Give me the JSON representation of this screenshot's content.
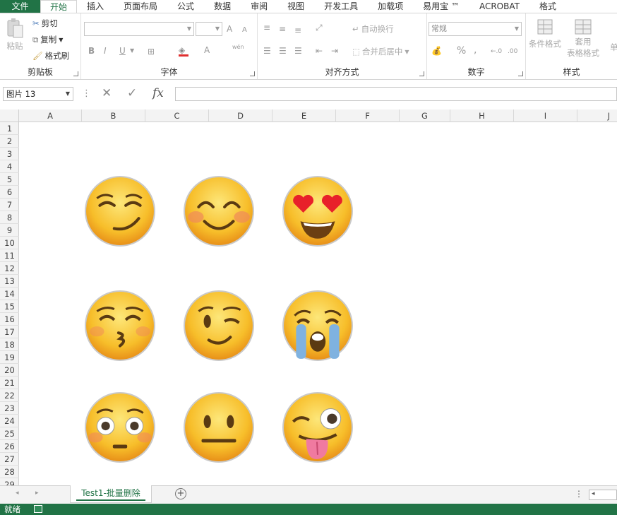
{
  "menu": {
    "file": "文件",
    "tabs": [
      "开始",
      "插入",
      "页面布局",
      "公式",
      "数据",
      "审阅",
      "视图",
      "开发工具",
      "加载项",
      "易用宝 ™",
      "ACROBAT",
      "格式"
    ]
  },
  "ribbon": {
    "clipboard": {
      "label": "剪贴板",
      "paste": "粘贴",
      "cut": "剪切",
      "copy": "复制",
      "format_painter": "格式刷"
    },
    "font": {
      "label": "字体",
      "grow": "A",
      "shrink": "A",
      "bold": "B",
      "italic": "I",
      "underline": "U",
      "font_color": "A",
      "phonetic": "wén"
    },
    "alignment": {
      "label": "对齐方式",
      "wrap": "自动换行",
      "merge": "合并后居中"
    },
    "number": {
      "label": "数字",
      "format": "常规",
      "percent": "%",
      "comma": ","
    },
    "styles": {
      "label": "样式",
      "conditional": "条件格式",
      "table_format_1": "套用",
      "table_format_2": "表格格式",
      "cell_styles": "单"
    }
  },
  "formula_bar": {
    "name_box": "图片 13",
    "fx": "fx",
    "value": ""
  },
  "columns": [
    "A",
    "B",
    "C",
    "D",
    "E",
    "F",
    "G",
    "H",
    "I",
    "J"
  ],
  "rows": [
    "1",
    "2",
    "3",
    "4",
    "5",
    "6",
    "7",
    "8",
    "9",
    "10",
    "11",
    "12",
    "13",
    "14",
    "15",
    "16",
    "17",
    "18",
    "19",
    "20",
    "21",
    "22",
    "23",
    "24",
    "25",
    "26",
    "27",
    "28",
    "29"
  ],
  "emojis": [
    "smirk-emoji",
    "smiling-blush-emoji",
    "heart-eyes-emoji",
    "kissing-emoji",
    "winking-emoji",
    "crying-emoji",
    "flushed-emoji",
    "neutral-face-emoji",
    "stuck-out-tongue-winking-emoji"
  ],
  "sheet": {
    "tab": "Test1-批量删除"
  },
  "status": {
    "ready": "就绪"
  },
  "colors": {
    "accent": "#217346",
    "emoji_face": "#f5b21c"
  }
}
